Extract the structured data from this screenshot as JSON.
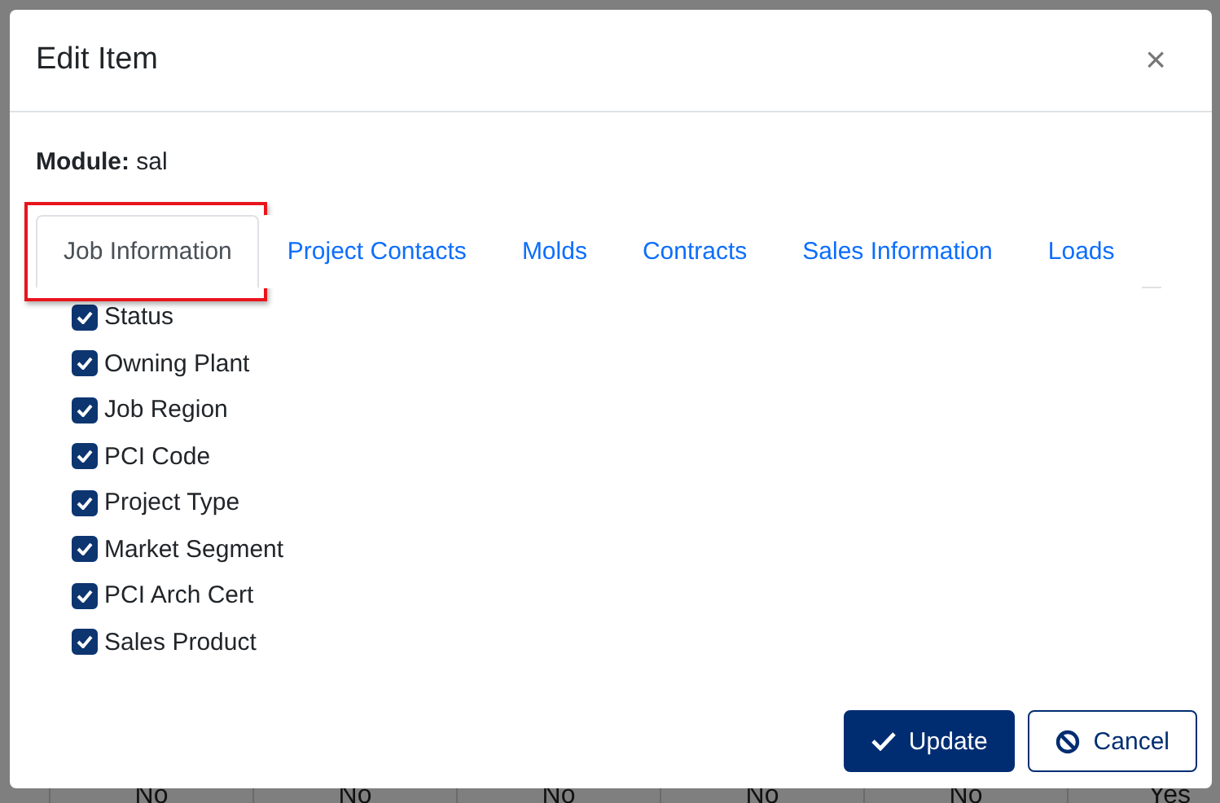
{
  "background_table": {
    "row": [
      "No",
      "No",
      "No",
      "No",
      "No",
      "Yes"
    ]
  },
  "dialog": {
    "title": "Edit Item",
    "close": "×",
    "module_label": "Module:",
    "module_value": "sal",
    "tabs": [
      {
        "label": "Job Information",
        "selected": true,
        "highlighted": true
      },
      {
        "label": "Project Contacts",
        "selected": false,
        "highlighted": false
      },
      {
        "label": "Molds",
        "selected": false,
        "highlighted": false
      },
      {
        "label": "Contracts",
        "selected": false,
        "highlighted": false
      },
      {
        "label": "Sales Information",
        "selected": false,
        "highlighted": false
      },
      {
        "label": "Loads",
        "selected": false,
        "highlighted": false
      }
    ],
    "fields": [
      {
        "label": "Status",
        "checked": true
      },
      {
        "label": "Owning Plant",
        "checked": true
      },
      {
        "label": "Job Region",
        "checked": true
      },
      {
        "label": "PCI Code",
        "checked": true
      },
      {
        "label": "Project Type",
        "checked": true
      },
      {
        "label": "Market Segment",
        "checked": true
      },
      {
        "label": "PCI Arch Cert",
        "checked": true
      },
      {
        "label": "Sales Product",
        "checked": true
      }
    ],
    "buttons": [
      {
        "label": "Update",
        "kind": "primary"
      },
      {
        "label": "Cancel",
        "kind": "secondary"
      }
    ]
  }
}
